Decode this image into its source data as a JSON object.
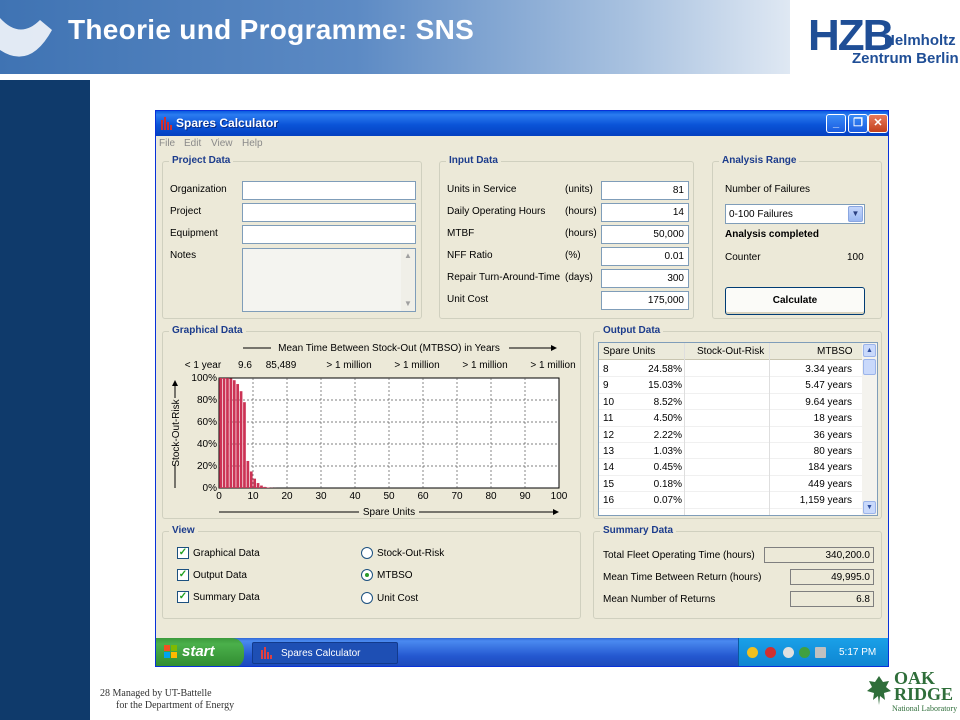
{
  "slide": {
    "title": "Theorie und Programme: SNS",
    "logo_mark": "HZB",
    "logo_line1": "Helmholtz",
    "logo_line2": "Zentrum Berlin",
    "page_number": "28",
    "footer_line1": "Managed by UT-Battelle",
    "footer_line2": "for the Department of Energy",
    "ornl_line1": "OAK",
    "ornl_line2": "RIDGE",
    "ornl_line3": "National Laboratory"
  },
  "window": {
    "title": "Spares Calculator",
    "menu": [
      "File",
      "Edit",
      "View",
      "Help"
    ]
  },
  "project_data": {
    "title": "Project Data",
    "labels": [
      "Organization",
      "Project",
      "Equipment",
      "Notes"
    ],
    "values": [
      "",
      "",
      "",
      ""
    ]
  },
  "input_data": {
    "title": "Input Data",
    "rows": [
      {
        "label": "Units in Service",
        "unit": "(units)",
        "value": "81"
      },
      {
        "label": "Daily Operating Hours",
        "unit": "(hours)",
        "value": "14"
      },
      {
        "label": "MTBF",
        "unit": "(hours)",
        "value": "50,000"
      },
      {
        "label": "NFF Ratio",
        "unit": "(%)",
        "value": "0.01"
      },
      {
        "label": "Repair Turn-Around-Time",
        "unit": "(days)",
        "value": "300"
      },
      {
        "label": "Unit Cost",
        "unit": "",
        "value": "175,000"
      }
    ]
  },
  "analysis_range": {
    "title": "Analysis Range",
    "failures_label": "Number of Failures",
    "failures_value": "0-100 Failures",
    "status": "Analysis completed",
    "counter_label": "Counter",
    "counter_value": "100",
    "calculate_label": "Calculate"
  },
  "graphical_data": {
    "title": "Graphical Data",
    "top_label": "Mean Time Between Stock-Out (MTBSO) in Years",
    "top_ticks": [
      "< 1 year",
      "9.6",
      "85,489",
      "> 1 million",
      "> 1 million",
      "> 1 million",
      "> 1 million"
    ],
    "y_label": "Stock-Out-Risk",
    "x_label": "Spare Units"
  },
  "chart_data": {
    "type": "bar",
    "title": "",
    "xlabel": "Spare Units",
    "ylabel": "Stock-Out-Risk",
    "secondary_xlabel": "Mean Time Between Stock-Out (MTBSO) in Years",
    "xlim": [
      0,
      100
    ],
    "ylim": [
      0,
      100
    ],
    "x_ticks": [
      "0",
      "10",
      "20",
      "30",
      "40",
      "50",
      "60",
      "70",
      "80",
      "90",
      "100"
    ],
    "y_ticks": [
      "0%",
      "20%",
      "40%",
      "60%",
      "80%",
      "100%"
    ],
    "grid": true,
    "x": [
      0,
      1,
      2,
      3,
      4,
      5,
      6,
      7,
      8,
      9,
      10,
      11,
      12,
      13,
      14,
      15,
      16
    ],
    "values": [
      100,
      100,
      99.9,
      99.5,
      98,
      94.5,
      88,
      78,
      24.58,
      15.03,
      8.52,
      4.5,
      2.22,
      1.03,
      0.45,
      0.18,
      0.07
    ],
    "bar_color": "#cc3355"
  },
  "output_data": {
    "title": "Output Data",
    "headers": [
      "Spare Units",
      "Stock-Out-Risk",
      "MTBSO"
    ],
    "rows": [
      [
        "8",
        "24.58%",
        "3.34 years"
      ],
      [
        "9",
        "15.03%",
        "5.47 years"
      ],
      [
        "10",
        "8.52%",
        "9.64 years"
      ],
      [
        "11",
        "4.50%",
        "18 years"
      ],
      [
        "12",
        "2.22%",
        "36 years"
      ],
      [
        "13",
        "1.03%",
        "80 years"
      ],
      [
        "14",
        "0.45%",
        "184 years"
      ],
      [
        "15",
        "0.18%",
        "449 years"
      ],
      [
        "16",
        "0.07%",
        "1,159 years"
      ]
    ]
  },
  "view": {
    "title": "View",
    "checkboxes": [
      {
        "label": "Graphical Data",
        "checked": true
      },
      {
        "label": "Output Data",
        "checked": true
      },
      {
        "label": "Summary Data",
        "checked": true
      }
    ],
    "radios": [
      {
        "label": "Stock-Out-Risk",
        "selected": false
      },
      {
        "label": "MTBSO",
        "selected": true
      },
      {
        "label": "Unit Cost",
        "selected": false
      }
    ]
  },
  "summary_data": {
    "title": "Summary Data",
    "rows": [
      {
        "label": "Total Fleet Operating Time (hours)",
        "value": "340,200.0"
      },
      {
        "label": "Mean Time Between Return (hours)",
        "value": "49,995.0"
      },
      {
        "label": "Mean Number of Returns",
        "value": "6.8"
      }
    ]
  },
  "taskbar": {
    "start_label": "start",
    "task_label": "Spares Calculator",
    "clock": "5:17 PM"
  }
}
